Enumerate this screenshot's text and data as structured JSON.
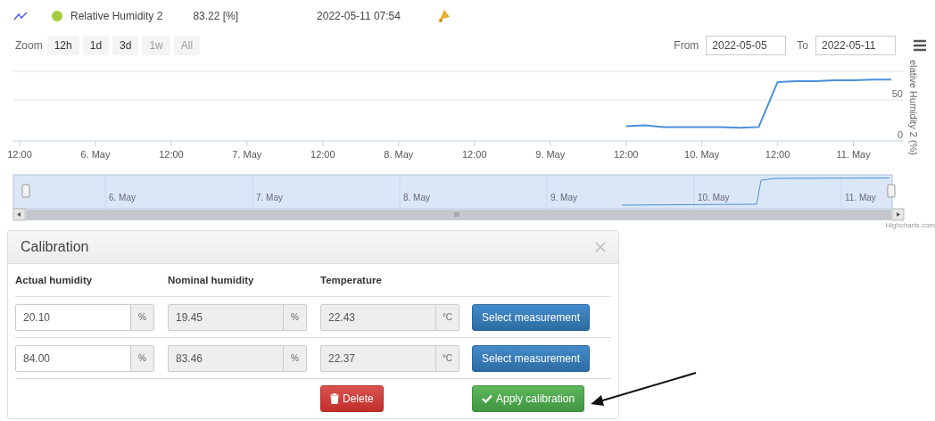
{
  "header": {
    "series_name": "Relative Humidity 2",
    "value": "83.22 [%]",
    "timestamp": "2022-05-11 07:54"
  },
  "range_selector": {
    "label": "Zoom",
    "buttons": [
      {
        "label": "12h",
        "disabled": false,
        "selected": false
      },
      {
        "label": "1d",
        "disabled": false,
        "selected": false
      },
      {
        "label": "3d",
        "disabled": false,
        "selected": false
      },
      {
        "label": "1w",
        "disabled": true,
        "selected": false
      },
      {
        "label": "All",
        "disabled": true,
        "selected": false
      }
    ],
    "from_label": "From",
    "from": "2022-05-05",
    "to_label": "To",
    "to": "2022-05-11"
  },
  "chart": {
    "chart_data": {
      "type": "line",
      "ylabel": "elative Humidity 2 (%)",
      "ylim": [
        0,
        85
      ],
      "categories": [
        "12:00",
        null,
        null,
        null,
        "6. May",
        null,
        null,
        null,
        "12:00",
        null,
        null,
        null,
        "7. May",
        null,
        null,
        null,
        "12:00",
        null,
        null,
        null,
        "8. May",
        null,
        null,
        null,
        "12:00",
        null,
        null,
        null,
        "9. May",
        null,
        null,
        null,
        "12:00",
        null,
        null,
        null,
        "10. May",
        null,
        null,
        null,
        "12:00",
        null,
        null,
        null,
        "11. May",
        null,
        null
      ],
      "yticks": [
        0,
        50
      ],
      "series": [
        {
          "color": "#4a90d9",
          "values": [
            null,
            null,
            null,
            null,
            null,
            null,
            null,
            null,
            null,
            null,
            null,
            null,
            null,
            null,
            null,
            null,
            null,
            null,
            null,
            null,
            null,
            null,
            null,
            null,
            null,
            null,
            null,
            null,
            null,
            null,
            null,
            null,
            18,
            19,
            17,
            17,
            17,
            17,
            16,
            17,
            72,
            73,
            73,
            74,
            74,
            75,
            75
          ]
        }
      ]
    }
  },
  "navigator": {
    "labels": [
      "6. May",
      "7. May",
      "8. May",
      "9. May",
      "10. May",
      "11. May"
    ]
  },
  "credits": "Highcharts.com",
  "calibration": {
    "title": "Calibration",
    "columns": [
      "Actual humidity",
      "Nominal humidity",
      "Temperature"
    ],
    "rows": [
      {
        "actual": "20.10",
        "actual_unit": "%",
        "nominal": "19.45",
        "nominal_unit": "%",
        "temperature": "22.43",
        "temperature_unit": "°C",
        "button": "Select measurement"
      },
      {
        "actual": "84.00",
        "actual_unit": "%",
        "nominal": "83.46",
        "nominal_unit": "%",
        "temperature": "22.37",
        "temperature_unit": "°C",
        "button": "Select measurement"
      }
    ],
    "delete_button": "Delete",
    "apply_button": "Apply calibration"
  }
}
